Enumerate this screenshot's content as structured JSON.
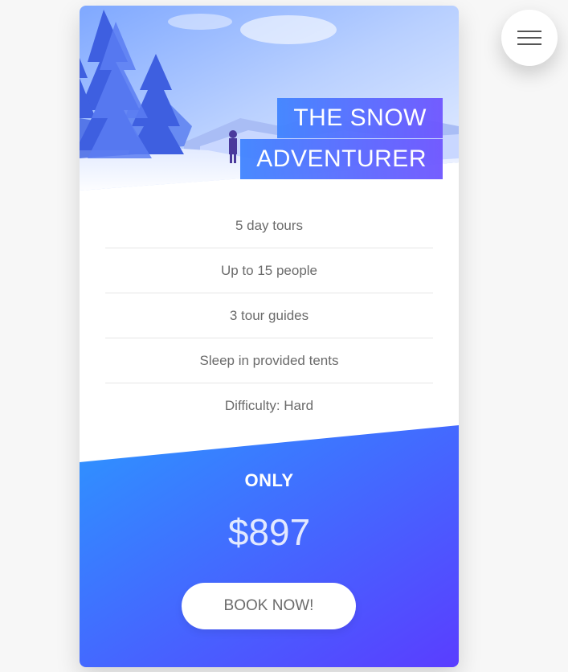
{
  "card": {
    "title_line1": "THE SNOW",
    "title_line2": "ADVENTURER",
    "features": [
      "5 day tours",
      "Up to 15 people",
      "3 tour guides",
      "Sleep in provided tents",
      "Difficulty: Hard"
    ],
    "price_label": "ONLY",
    "price": "$897",
    "book_button_label": "BOOK NOW!"
  },
  "menu": {
    "icon": "hamburger-menu-icon"
  },
  "colors": {
    "gradient_start": "#2d95ff",
    "gradient_end": "#5a3dff",
    "page_background": "#f7f7f7",
    "text_muted": "#6b6b6b"
  }
}
